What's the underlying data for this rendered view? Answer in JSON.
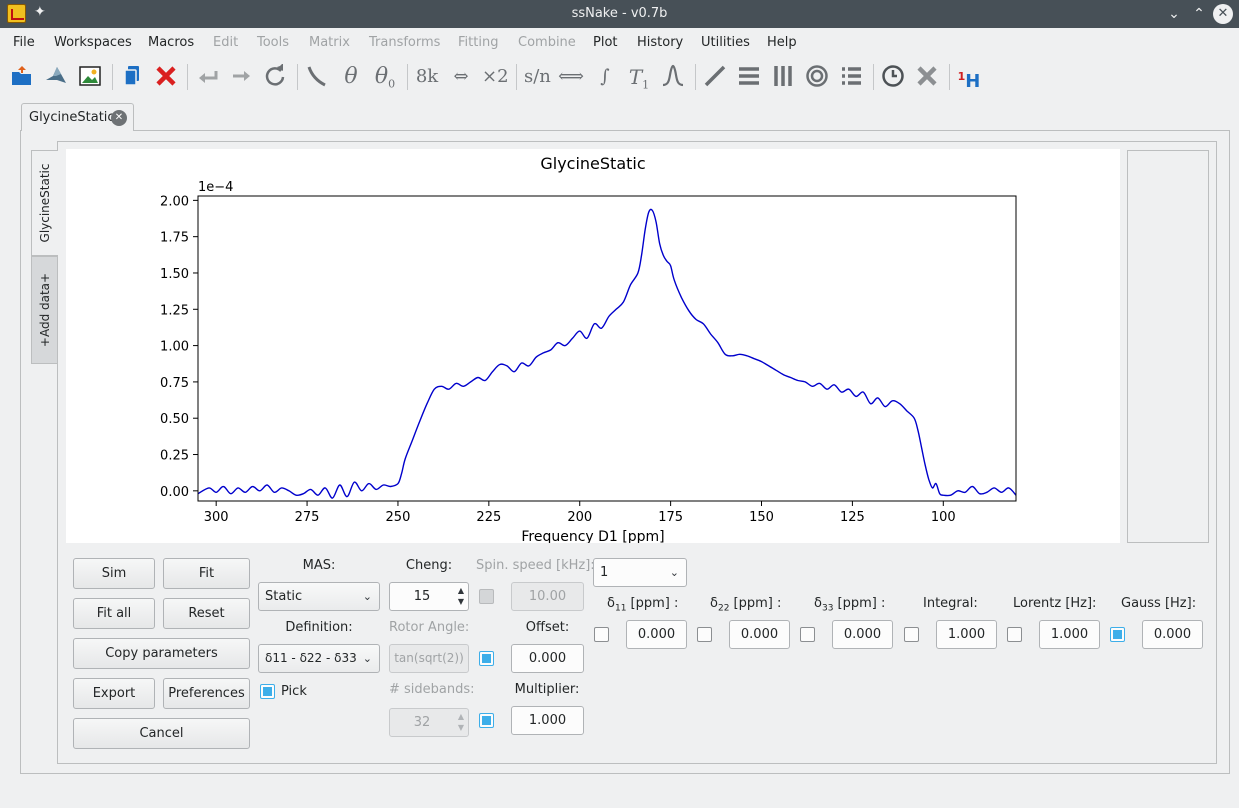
{
  "window": {
    "title": "ssNake - v0.7b"
  },
  "menu": [
    "File",
    "Workspaces",
    "Macros",
    "Edit",
    "Tools",
    "Matrix",
    "Transforms",
    "Fitting",
    "Combine",
    "Plot",
    "History",
    "Utilities",
    "Help"
  ],
  "toolbar": {
    "k8": "8k",
    "x2": "×2",
    "sn": "s/n",
    "theta": "θ",
    "theta0": "θ",
    "theta0_sub": "0",
    "t1": "T",
    "t1_sub": "1",
    "h1_sup": "1",
    "h1": "H"
  },
  "tabs": {
    "main": "GlycineStatic",
    "side": "GlycineStatic",
    "add": "+Add data+"
  },
  "plot": {
    "title": "GlycineStatic",
    "xlabel": "Frequency D1 [ppm]",
    "yexp": "1e−4"
  },
  "chart_data": {
    "type": "line",
    "title": "GlycineStatic",
    "xlabel": "Frequency D1 [ppm]",
    "ylabel": "",
    "y_scale_label": "1e−4",
    "xlim": [
      305,
      80
    ],
    "ylim": [
      -0.07,
      2.03
    ],
    "xticks": [
      300,
      275,
      250,
      225,
      200,
      175,
      150,
      125,
      100
    ],
    "yticks": [
      0.0,
      0.25,
      0.5,
      0.75,
      1.0,
      1.25,
      1.5,
      1.75,
      2.0
    ],
    "ytick_labels": [
      "0.00",
      "0.25",
      "0.50",
      "0.75",
      "1.00",
      "1.25",
      "1.50",
      "1.75",
      "2.00"
    ],
    "color": "#0000cc",
    "x": [
      305,
      302,
      300,
      298,
      296,
      294,
      292,
      290,
      288,
      286,
      284,
      282,
      280,
      278,
      276,
      274,
      272,
      270,
      268,
      266,
      264,
      262,
      260,
      258,
      256,
      254,
      252,
      250,
      249,
      248,
      246,
      244,
      242,
      240,
      238,
      236,
      234,
      232,
      230,
      228,
      226,
      224,
      222,
      220,
      218,
      216,
      214,
      212,
      210,
      208,
      206,
      204,
      202,
      200,
      198,
      196,
      194,
      192,
      190,
      188,
      186,
      184,
      183,
      182,
      181,
      180,
      179,
      178,
      177,
      176,
      175,
      174,
      172,
      170,
      168,
      166,
      164,
      162,
      160,
      158,
      156,
      154,
      152,
      150,
      148,
      146,
      144,
      142,
      140,
      138,
      136,
      134,
      132,
      130,
      128,
      126,
      124,
      122,
      120,
      118,
      116,
      114,
      112,
      110,
      108,
      107,
      106,
      105,
      104,
      103,
      102,
      101,
      100,
      98,
      96,
      94,
      92,
      90,
      88,
      86,
      84,
      82,
      80
    ],
    "values": [
      -0.02,
      0.02,
      -0.01,
      0.03,
      -0.02,
      0.02,
      -0.01,
      0.03,
      0.0,
      0.04,
      -0.01,
      0.02,
      0.0,
      -0.03,
      -0.02,
      0.01,
      -0.03,
      0.02,
      -0.05,
      0.04,
      -0.04,
      0.06,
      0.0,
      0.05,
      0.01,
      0.04,
      0.03,
      0.05,
      0.12,
      0.22,
      0.35,
      0.48,
      0.6,
      0.7,
      0.72,
      0.7,
      0.74,
      0.72,
      0.75,
      0.78,
      0.76,
      0.82,
      0.87,
      0.86,
      0.82,
      0.88,
      0.86,
      0.92,
      0.95,
      0.97,
      1.02,
      1.0,
      1.05,
      1.1,
      1.05,
      1.15,
      1.12,
      1.2,
      1.25,
      1.3,
      1.42,
      1.5,
      1.62,
      1.8,
      1.92,
      1.93,
      1.85,
      1.7,
      1.62,
      1.58,
      1.55,
      1.45,
      1.33,
      1.24,
      1.18,
      1.15,
      1.08,
      1.02,
      0.94,
      0.93,
      0.94,
      0.93,
      0.91,
      0.89,
      0.86,
      0.83,
      0.8,
      0.78,
      0.76,
      0.75,
      0.72,
      0.74,
      0.7,
      0.73,
      0.68,
      0.7,
      0.65,
      0.68,
      0.6,
      0.64,
      0.58,
      0.62,
      0.6,
      0.55,
      0.5,
      0.42,
      0.3,
      0.18,
      0.08,
      0.02,
      0.05,
      -0.02,
      -0.03,
      -0.03,
      0.0,
      -0.01,
      0.03,
      -0.02,
      -0.01,
      0.02,
      -0.01,
      0.02,
      -0.03
    ]
  },
  "controls": {
    "sim": "Sim",
    "fit": "Fit",
    "fit_all": "Fit all",
    "reset": "Reset",
    "copy_params": "Copy parameters",
    "export": "Export",
    "preferences": "Preferences",
    "cancel": "Cancel",
    "mas_label": "MAS:",
    "mas_value": "Static",
    "definition_label": "Definition:",
    "definition_value": "δ11 - δ22 - δ33",
    "pick": "Pick",
    "cheng_label": "Cheng:",
    "cheng_value": "15",
    "rotor_angle_label": "Rotor Angle:",
    "rotor_angle_value": "tan(sqrt(2))",
    "sidebands_label": "# sidebands:",
    "sidebands_value": "32",
    "spin_speed_label": "Spin. speed [kHz]:",
    "spin_speed_value": "10.00",
    "offset_label": "Offset:",
    "offset_value": "0.000",
    "multiplier_label": "Multiplier:",
    "multiplier_value": "1.000",
    "site_count": "1",
    "d11_label": "δ",
    "d11_sub": "11",
    "d11_unit": " [ppm] :",
    "d11_value": "0.000",
    "d22_label": "δ",
    "d22_sub": "22",
    "d22_unit": " [ppm] :",
    "d22_value": "0.000",
    "d33_label": "δ",
    "d33_sub": "33",
    "d33_unit": " [ppm] :",
    "d33_value": "0.000",
    "integral_label": "Integral:",
    "integral_value": "1.000",
    "lorentz_label": "Lorentz [Hz]:",
    "lorentz_value": "1.000",
    "gauss_label": "Gauss [Hz]:",
    "gauss_value": "0.000"
  }
}
